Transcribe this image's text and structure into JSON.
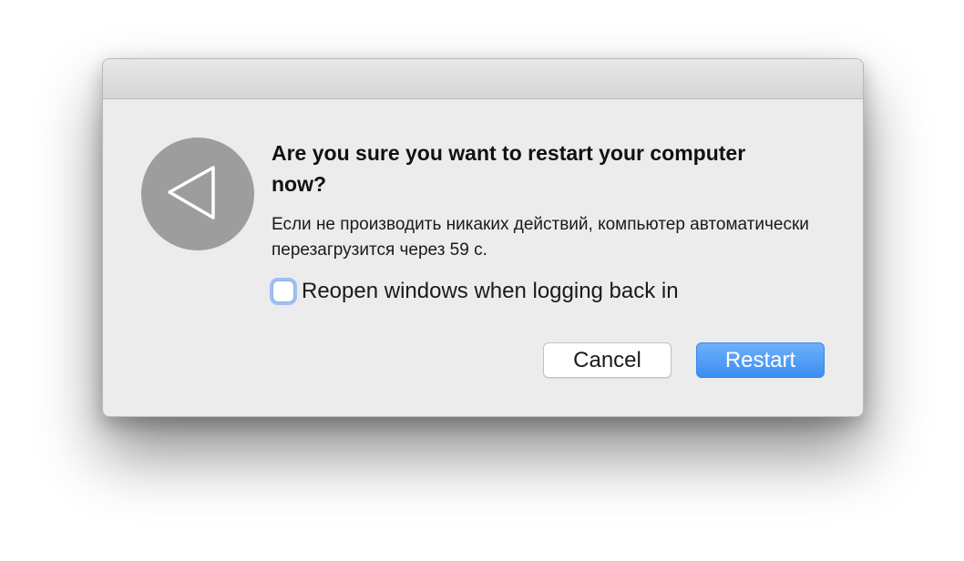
{
  "dialog": {
    "icon": "back-triangle-icon",
    "heading": "Are you sure you want to restart your computer now?",
    "message": "Если не производить никаких действий, компьютер автоматически перезагрузится через 59 с.",
    "checkbox": {
      "label": "Reopen windows when logging back in",
      "checked": false
    },
    "buttons": {
      "cancel_label": "Cancel",
      "restart_label": "Restart"
    },
    "colors": {
      "accent": "#3d8ef2",
      "icon_background": "#9d9d9d"
    }
  }
}
